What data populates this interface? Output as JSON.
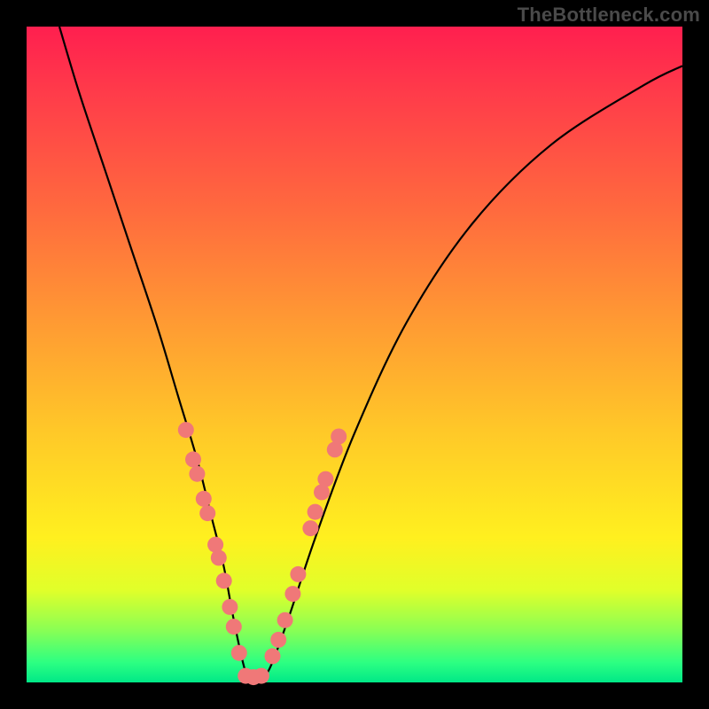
{
  "watermark": "TheBottleneck.com",
  "colors": {
    "background_frame": "#000000",
    "gradient_top": "#ff1f4f",
    "gradient_bottom": "#00e887",
    "curve_stroke": "#000000",
    "marker_fill": "#f07878"
  },
  "chart_data": {
    "type": "line",
    "title": "",
    "xlabel": "",
    "ylabel": "",
    "xlim": [
      0,
      100
    ],
    "ylim": [
      0,
      100
    ],
    "legend": false,
    "grid": false,
    "annotations": [
      "TheBottleneck.com"
    ],
    "series": [
      {
        "name": "bottleneck-curve",
        "x": [
          5,
          8,
          12,
          16,
          20,
          23,
          26,
          28,
          30,
          31.5,
          33,
          34,
          35,
          37,
          40,
          44,
          50,
          58,
          68,
          80,
          94,
          100
        ],
        "y": [
          100,
          90,
          78,
          66,
          54,
          44,
          34,
          26,
          18,
          10,
          3,
          0,
          0,
          2,
          10,
          22,
          38,
          55,
          70,
          82,
          91,
          94
        ]
      }
    ],
    "markers": {
      "name": "highlighted-points",
      "description": "salmon circular markers clustered near the valley on both arms",
      "points": [
        {
          "x": 24.3,
          "y": 38.5
        },
        {
          "x": 25.4,
          "y": 34.0
        },
        {
          "x": 26.0,
          "y": 31.8
        },
        {
          "x": 27.0,
          "y": 28.0
        },
        {
          "x": 27.6,
          "y": 25.8
        },
        {
          "x": 28.8,
          "y": 21.0
        },
        {
          "x": 29.3,
          "y": 19.0
        },
        {
          "x": 30.1,
          "y": 15.5
        },
        {
          "x": 31.0,
          "y": 11.5
        },
        {
          "x": 31.6,
          "y": 8.5
        },
        {
          "x": 32.4,
          "y": 4.5
        },
        {
          "x": 33.4,
          "y": 1.0
        },
        {
          "x": 34.6,
          "y": 0.8
        },
        {
          "x": 35.8,
          "y": 1.0
        },
        {
          "x": 37.5,
          "y": 4.0
        },
        {
          "x": 38.4,
          "y": 6.5
        },
        {
          "x": 39.4,
          "y": 9.5
        },
        {
          "x": 40.6,
          "y": 13.5
        },
        {
          "x": 41.4,
          "y": 16.5
        },
        {
          "x": 43.3,
          "y": 23.5
        },
        {
          "x": 44.0,
          "y": 26.0
        },
        {
          "x": 45.0,
          "y": 29.0
        },
        {
          "x": 45.6,
          "y": 31.0
        },
        {
          "x": 47.0,
          "y": 35.5
        },
        {
          "x": 47.6,
          "y": 37.5
        }
      ],
      "radius_px": 9
    }
  }
}
